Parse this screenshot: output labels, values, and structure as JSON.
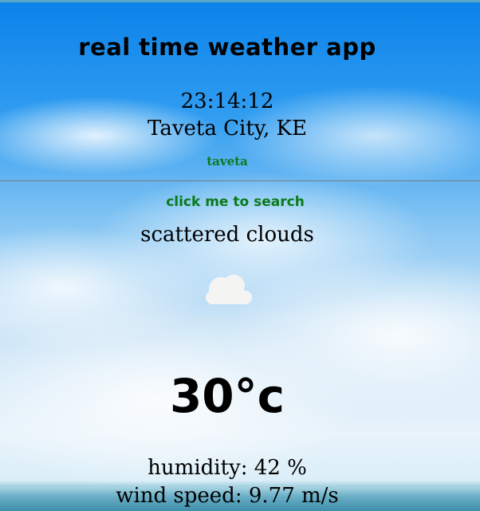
{
  "header": {
    "title": "real time weather app",
    "time": "23:14:12",
    "location": "Taveta City, KE"
  },
  "search": {
    "value": "taveta",
    "button_label": "click me to search"
  },
  "weather": {
    "description": "scattered clouds",
    "icon": "cloud-icon",
    "temperature": "30°c",
    "humidity_label": "humidity: 42 %",
    "wind_label": "wind speed: 9.77 m/s"
  },
  "colors": {
    "accent_text": "#0a7a1a",
    "sky_top": "#0b82ea",
    "sky_bottom": "#e8f3fb"
  }
}
